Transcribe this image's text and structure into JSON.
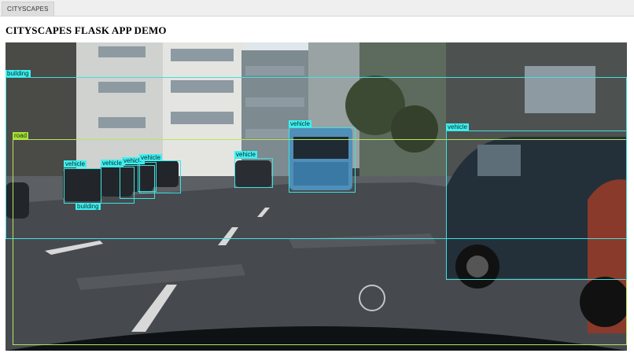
{
  "header": {
    "tab_label": "CITYSCAPES"
  },
  "page": {
    "title": "CITYSCAPES FLASK APP DEMO"
  },
  "detection": {
    "colors": {
      "building": "#40e0e0",
      "vehicle": "#40e0e0",
      "road": "#b5e65a"
    },
    "labels": {
      "building_1": "building",
      "road": "road",
      "vehicle_1": "vehicle",
      "vehicle_2": "vehicle",
      "vehicle_3": "vehicle",
      "vehicle_4": "vehicle",
      "vehicle_5": "vehicle",
      "vehicle_6": "vehicle",
      "vehicle_7": "vehicle",
      "building_2": "building"
    }
  }
}
